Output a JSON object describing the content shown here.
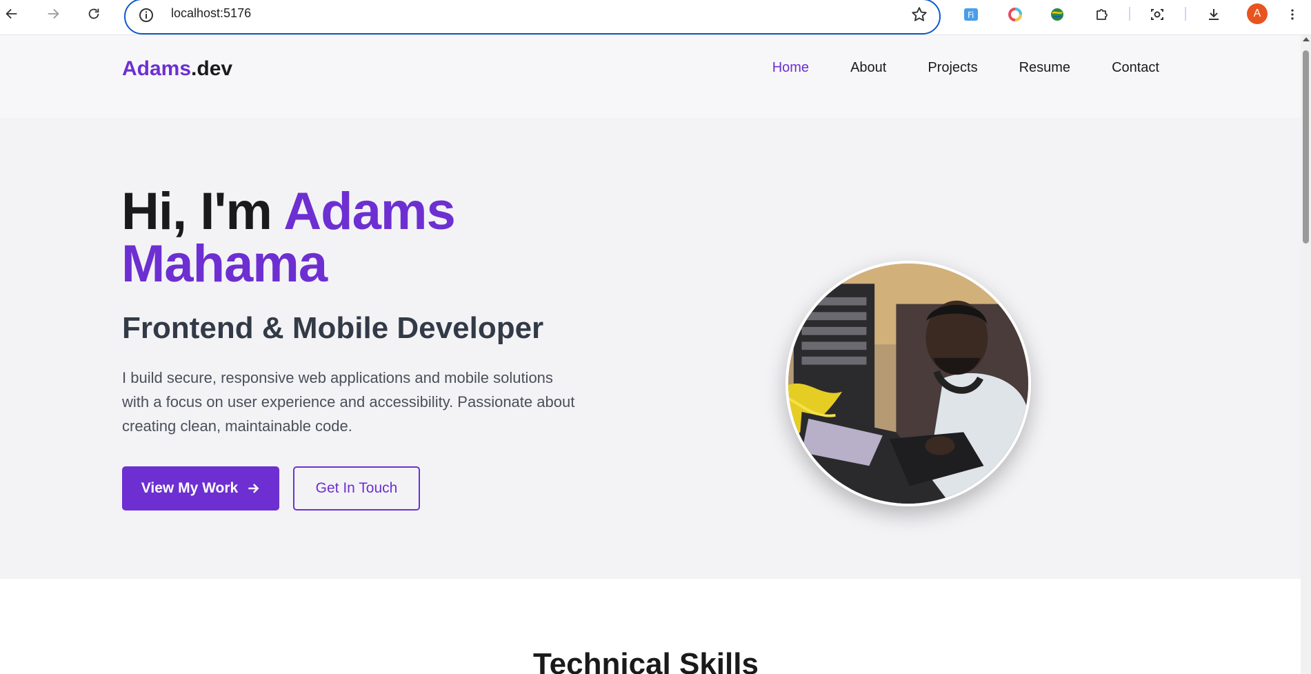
{
  "browser": {
    "url": "localhost:5176",
    "profile_initial": "A",
    "icons": {
      "back": "arrow-left-icon",
      "forward": "arrow-right-icon",
      "reload": "reload-icon",
      "info": "info-icon",
      "bookmark": "star-icon",
      "extensions": "puzzle-icon",
      "screenshot": "camera-icon",
      "downloads": "download-icon",
      "menu": "kebab-menu-icon"
    }
  },
  "site": {
    "logo": {
      "main": "Adams",
      "suffix": ".dev"
    },
    "nav": [
      {
        "label": "Home",
        "active": true
      },
      {
        "label": "About",
        "active": false
      },
      {
        "label": "Projects",
        "active": false
      },
      {
        "label": "Resume",
        "active": false
      },
      {
        "label": "Contact",
        "active": false
      }
    ]
  },
  "hero": {
    "greeting": "Hi, I'm ",
    "name": "Adams Mahama",
    "subtitle": "Frontend & Mobile Developer",
    "description": "I build secure, responsive web applications and mobile solutions with a focus on user experience and accessibility. Passionate about creating clean, maintainable code.",
    "primary_button": "View My Work",
    "secondary_button": "Get In Touch"
  },
  "skills": {
    "title": "Technical Skills"
  },
  "colors": {
    "accent": "#6d2fd1",
    "text": "#1a1a1a",
    "hero_bg": "#f3f3f6",
    "header_bg": "#f7f7f9",
    "browser_focus": "#0b57d0"
  }
}
